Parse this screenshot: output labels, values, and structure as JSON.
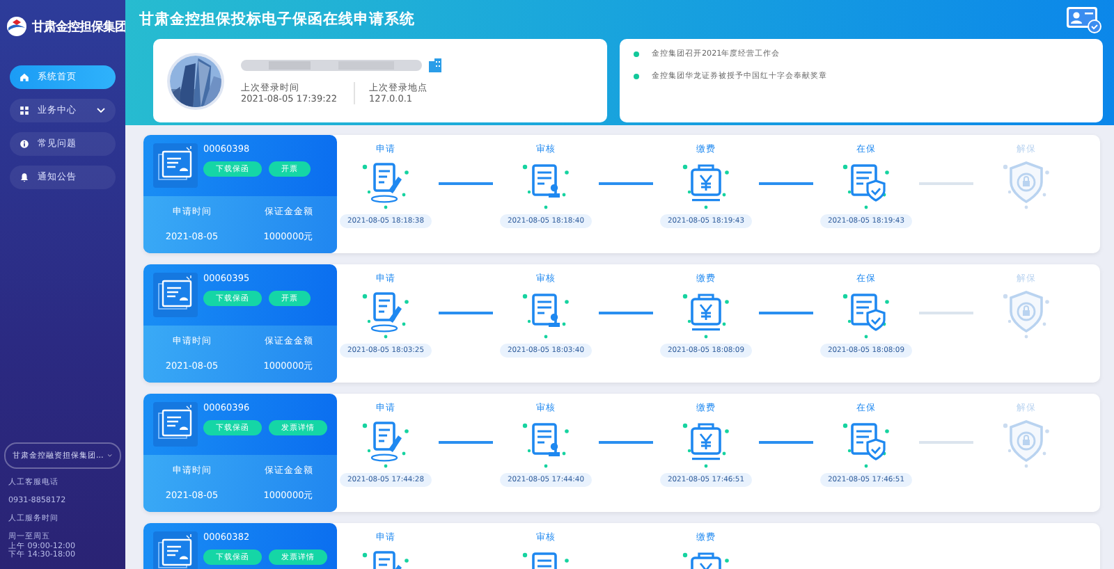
{
  "sidebar": {
    "logo_text": "甘肃金控担保集团",
    "items": [
      {
        "label": "系统首页",
        "selected": true,
        "has_submenu": false
      },
      {
        "label": "业务中心",
        "selected": false,
        "has_submenu": true
      },
      {
        "label": "常见问题",
        "selected": false,
        "has_submenu": false
      },
      {
        "label": "通知公告",
        "selected": false,
        "has_submenu": false
      }
    ],
    "company_select": "甘肃金控融资担保集团...",
    "contact": [
      "人工客服电话",
      "0931-8858172",
      "人工服务时间"
    ],
    "hours": [
      "周一至周五",
      "上午 09:00-12:00",
      "下午 14:30-18:00"
    ]
  },
  "header": {
    "title": "甘肃金控担保投标电子保函在线申请系统"
  },
  "user": {
    "last_login_time_label": "上次登录时间",
    "last_login_time": "2021-08-05 17:39:22",
    "last_login_place_label": "上次登录地点",
    "last_login_place": "127.0.0.1"
  },
  "news": [
    "金控集团召开2021年度经营工作会",
    "金控集团华龙证券被授予中国红十字会奉献奖章"
  ],
  "applications": [
    {
      "number": "00060398",
      "buttons": [
        "下载保函",
        "开票"
      ],
      "date_label": "申请时间",
      "amount_label": "保证金金额",
      "date": "2021-08-05",
      "amount": "1000000元",
      "steps": [
        {
          "label": "申请",
          "kind": "apply",
          "done": true,
          "time": "2021-08-05 18:18:38"
        },
        {
          "label": "审核",
          "kind": "review",
          "done": true,
          "time": "2021-08-05 18:18:40"
        },
        {
          "label": "缴费",
          "kind": "pay",
          "done": true,
          "time": "2021-08-05 18:19:43"
        },
        {
          "label": "在保",
          "kind": "insure",
          "done": true,
          "time": "2021-08-05 18:19:43"
        },
        {
          "label": "解保",
          "kind": "release",
          "done": false
        }
      ]
    },
    {
      "number": "00060395",
      "buttons": [
        "下载保函",
        "开票"
      ],
      "date_label": "申请时间",
      "amount_label": "保证金金额",
      "date": "2021-08-05",
      "amount": "1000000元",
      "steps": [
        {
          "label": "申请",
          "kind": "apply",
          "done": true,
          "time": "2021-08-05 18:03:25"
        },
        {
          "label": "审核",
          "kind": "review",
          "done": true,
          "time": "2021-08-05 18:03:40"
        },
        {
          "label": "缴费",
          "kind": "pay",
          "done": true,
          "time": "2021-08-05 18:08:09"
        },
        {
          "label": "在保",
          "kind": "insure",
          "done": true,
          "time": "2021-08-05 18:08:09"
        },
        {
          "label": "解保",
          "kind": "release",
          "done": false
        }
      ]
    },
    {
      "number": "00060396",
      "buttons": [
        "下载保函",
        "发票详情"
      ],
      "date_label": "申请时间",
      "amount_label": "保证金金额",
      "date": "2021-08-05",
      "amount": "1000000元",
      "steps": [
        {
          "label": "申请",
          "kind": "apply",
          "done": true,
          "time": "2021-08-05 17:44:28"
        },
        {
          "label": "审核",
          "kind": "review",
          "done": true,
          "time": "2021-08-05 17:44:40"
        },
        {
          "label": "缴费",
          "kind": "pay",
          "done": true,
          "time": "2021-08-05 17:46:51"
        },
        {
          "label": "在保",
          "kind": "insure",
          "done": true,
          "time": "2021-08-05 17:46:51"
        },
        {
          "label": "解保",
          "kind": "release",
          "done": false
        }
      ]
    },
    {
      "number": "00060382",
      "buttons": [
        "下载保函",
        "发票详情"
      ],
      "steps": [
        {
          "label": "申请",
          "kind": "apply",
          "done": true
        },
        {
          "label": "审核",
          "kind": "review",
          "done": true
        },
        {
          "label": "缴费",
          "kind": "pay",
          "done": true
        }
      ]
    }
  ]
}
